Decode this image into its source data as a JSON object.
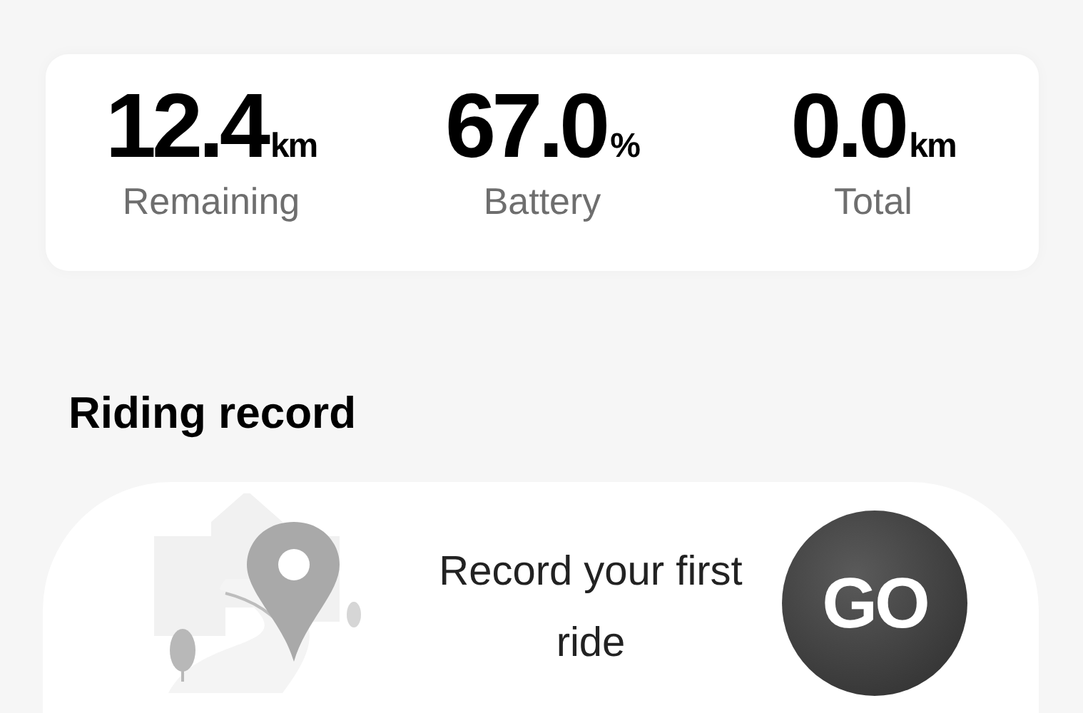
{
  "stats": [
    {
      "value": "12.4",
      "unit": "km",
      "label": "Remaining"
    },
    {
      "value": "67.0",
      "unit": "%",
      "label": "Battery"
    },
    {
      "value": "0.0",
      "unit": "km",
      "label": "Total"
    }
  ],
  "riding_record": {
    "title": "Riding record",
    "prompt": "Record your first ride",
    "go_button": "GO"
  }
}
